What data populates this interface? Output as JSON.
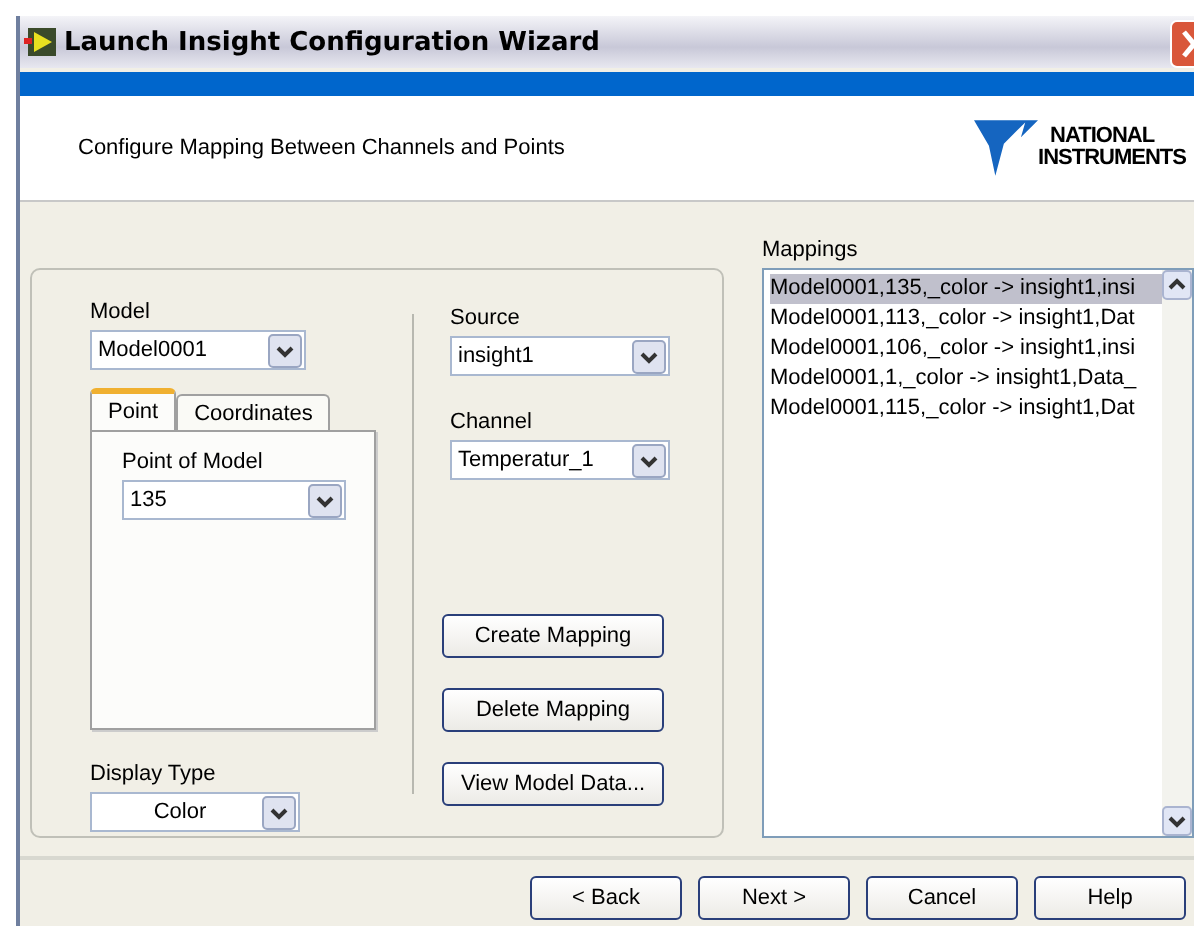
{
  "window": {
    "title": "Launch Insight Configuration Wizard"
  },
  "header": {
    "subtitle": "Configure Mapping Between Channels and Points",
    "logo_line_1": "NATIONAL",
    "logo_line_2": "INSTRUMENTS"
  },
  "model": {
    "label": "Model",
    "value": "Model0001"
  },
  "tabs": [
    {
      "label": "Point",
      "selected": true
    },
    {
      "label": "Coordinates",
      "selected": false
    }
  ],
  "point_of_model": {
    "label": "Point of Model",
    "value": "135"
  },
  "display_type": {
    "label": "Display Type",
    "value": "Color"
  },
  "source": {
    "label": "Source",
    "value": "insight1"
  },
  "channel": {
    "label": "Channel",
    "value": "Temperatur_1"
  },
  "actions": [
    "Create Mapping",
    "Delete Mapping",
    "View Model Data..."
  ],
  "mappings": {
    "label": "Mappings",
    "items": [
      {
        "text": "Model0001,135,_color -> insight1,insi",
        "selected": true
      },
      {
        "text": "Model0001,113,_color -> insight1,Dat",
        "selected": false
      },
      {
        "text": "Model0001,106,_color -> insight1,insi",
        "selected": false
      },
      {
        "text": "Model0001,1,_color -> insight1,Data_",
        "selected": false
      },
      {
        "text": "Model0001,115,_color -> insight1,Dat",
        "selected": false
      }
    ]
  },
  "buttons": [
    "< Back",
    "Next >",
    "Cancel",
    "Help"
  ]
}
